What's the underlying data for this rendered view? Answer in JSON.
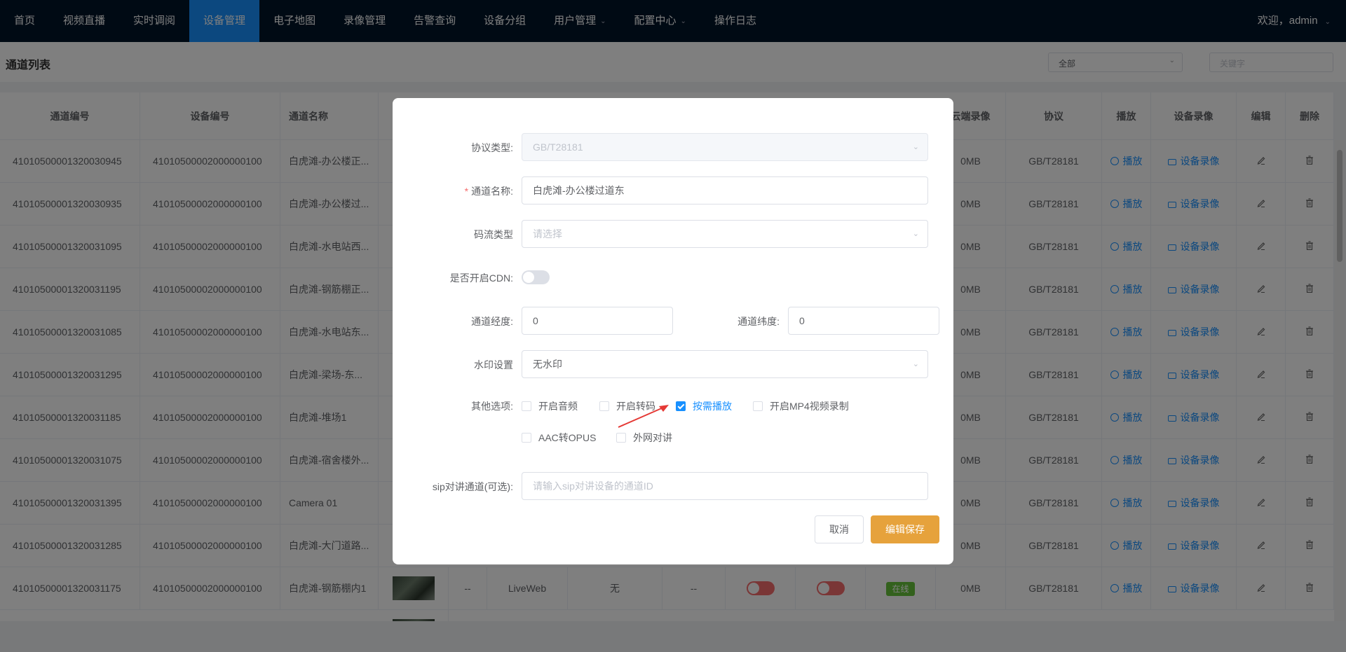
{
  "nav": {
    "items": [
      "首页",
      "视频直播",
      "实时调阅",
      "设备管理",
      "电子地图",
      "录像管理",
      "告警查询",
      "设备分组",
      "用户管理",
      "配置中心",
      "操作日志"
    ],
    "active_index": 3,
    "user": "欢迎，admin"
  },
  "subhead": {
    "title": "通道列表",
    "filter_value": "全部",
    "search_placeholder": "关键字"
  },
  "table": {
    "headers": [
      "通道编号",
      "设备编号",
      "通道名称",
      "",
      "",
      "",
      "",
      "",
      "",
      "",
      "",
      "云端录像",
      "协议",
      "播放",
      "设备录像",
      "编辑",
      "删除"
    ],
    "play_label": "播放",
    "record_label": "设备录像",
    "rows": [
      {
        "channel_id": "41010500001320030945",
        "device_id": "41010500002000000100",
        "name": "白虎滩-办公楼正...",
        "cloud": "0MB",
        "protocol": "GB/T28181"
      },
      {
        "channel_id": "41010500001320030935",
        "device_id": "41010500002000000100",
        "name": "白虎滩-办公楼过...",
        "cloud": "0MB",
        "protocol": "GB/T28181"
      },
      {
        "channel_id": "41010500001320031095",
        "device_id": "41010500002000000100",
        "name": "白虎滩-水电站西...",
        "cloud": "0MB",
        "protocol": "GB/T28181"
      },
      {
        "channel_id": "41010500001320031195",
        "device_id": "41010500002000000100",
        "name": "白虎滩-钢筋棚正...",
        "cloud": "0MB",
        "protocol": "GB/T28181"
      },
      {
        "channel_id": "41010500001320031085",
        "device_id": "41010500002000000100",
        "name": "白虎滩-水电站东...",
        "cloud": "0MB",
        "protocol": "GB/T28181"
      },
      {
        "channel_id": "41010500001320031295",
        "device_id": "41010500002000000100",
        "name": "白虎滩-梁场-东...",
        "cloud": "0MB",
        "protocol": "GB/T28181"
      },
      {
        "channel_id": "41010500001320031185",
        "device_id": "41010500002000000100",
        "name": "白虎滩-堆场1",
        "cloud": "0MB",
        "protocol": "GB/T28181"
      },
      {
        "channel_id": "41010500001320031075",
        "device_id": "41010500002000000100",
        "name": "白虎滩-宿舍楼外...",
        "cloud": "0MB",
        "protocol": "GB/T28181"
      },
      {
        "channel_id": "41010500001320031395",
        "device_id": "41010500002000000100",
        "name": "Camera 01",
        "cloud": "0MB",
        "protocol": "GB/T28181"
      },
      {
        "channel_id": "41010500001320031285",
        "device_id": "41010500002000000100",
        "name": "白虎滩-大门道路...",
        "cloud": "0MB",
        "protocol": "GB/T28181"
      },
      {
        "channel_id": "41010500001320031175",
        "device_id": "41010500002000000100",
        "name": "白虎滩-钢筋棚内1",
        "cloud": "0MB",
        "protocol": "GB/T28181",
        "dash1": "--",
        "stream": "LiveWeb",
        "watermark": "无",
        "dash2": "--",
        "status": "在线"
      }
    ]
  },
  "dialog": {
    "protocol_label": "协议类型:",
    "protocol_value": "GB/T28181",
    "name_label": "通道名称:",
    "name_value": "白虎滩-办公楼过道东",
    "stream_label": "码流类型",
    "stream_placeholder": "请选择",
    "cdn_label": "是否开启CDN:",
    "cdn_enabled": false,
    "lng_label": "通道经度:",
    "lng_value": "0",
    "lat_label": "通道纬度:",
    "lat_value": "0",
    "watermark_label": "水印设置",
    "watermark_value": "无水印",
    "options_label": "其他选项:",
    "options": [
      {
        "label": "开启音频",
        "checked": false
      },
      {
        "label": "开启转码",
        "checked": false
      },
      {
        "label": "按需播放",
        "checked": true
      },
      {
        "label": "开启MP4视频录制",
        "checked": false
      },
      {
        "label": "AAC转OPUS",
        "checked": false
      },
      {
        "label": "外网对讲",
        "checked": false
      }
    ],
    "sip_label": "sip对讲通道(可选):",
    "sip_placeholder": "请输入sip对讲设备的通道ID",
    "cancel_label": "取消",
    "save_label": "编辑保存"
  },
  "colors": {
    "nav_bg": "#001529",
    "accent": "#1890ff",
    "save_button": "#e6a23c",
    "annotation_arrow": "#e53935",
    "toggle_off_red": "#f56c6c",
    "online_tag": "#67c23a"
  }
}
